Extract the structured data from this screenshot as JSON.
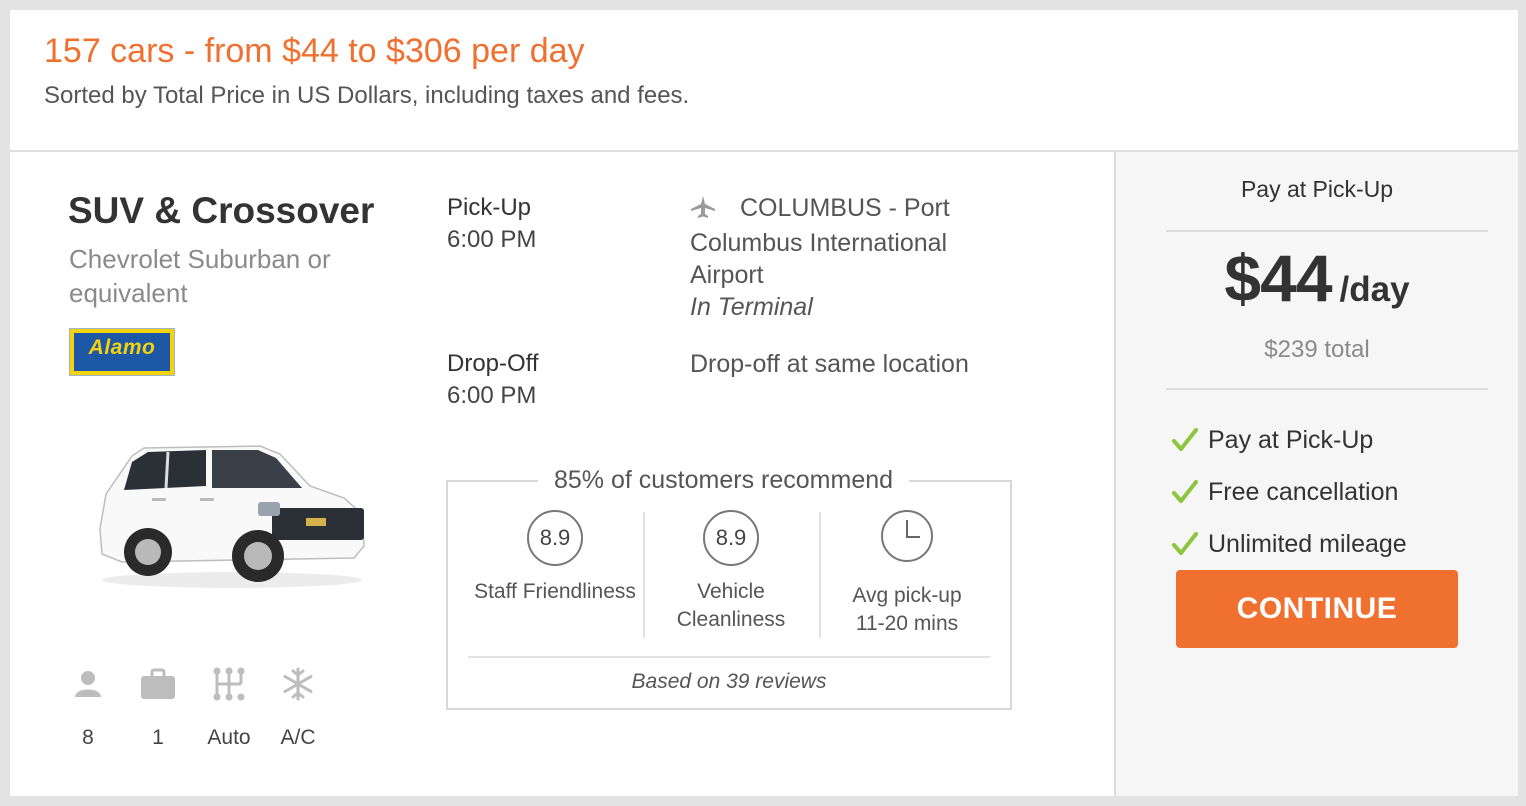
{
  "header": {
    "title": "157 cars - from $44 to $306 per day",
    "subtitle": "Sorted by Total Price in US Dollars, including taxes and fees."
  },
  "car": {
    "type": "SUV & Crossover",
    "model": "Chevrolet Suburban or equivalent",
    "vendor_logo_text": "Alamo",
    "features": [
      {
        "icon": "person-icon",
        "label": "8"
      },
      {
        "icon": "suitcase-icon",
        "label": "1"
      },
      {
        "icon": "gear-shift-icon",
        "label": "Auto"
      },
      {
        "icon": "snowflake-icon",
        "label": "A/C"
      }
    ]
  },
  "pickup": {
    "label": "Pick-Up",
    "time": "6:00 PM",
    "location_line1": "COLUMBUS - Port Columbus International Airport",
    "location_note": "In Terminal",
    "icon": "airplane-icon"
  },
  "dropoff": {
    "label": "Drop-Off",
    "time": "6:00 PM",
    "location": "Drop-off at same location"
  },
  "ratings": {
    "title": "85% of customers recommend",
    "staff_score": "8.9",
    "staff_label": "Staff Friendliness",
    "vehicle_score": "8.9",
    "vehicle_label": "Vehicle Cleanliness",
    "pickup_label": "Avg pick-up",
    "pickup_time": "11-20 mins",
    "footer": "Based on 39 reviews"
  },
  "pricing": {
    "pay_title": "Pay at Pick-Up",
    "price": "$44",
    "per": "/day",
    "total": "$239 total",
    "benefits": [
      "Pay at Pick-Up",
      "Free cancellation",
      "Unlimited mileage"
    ],
    "continue_label": "CONTINUE",
    "accent_color": "#f07030",
    "check_color": "#8cc63f"
  }
}
